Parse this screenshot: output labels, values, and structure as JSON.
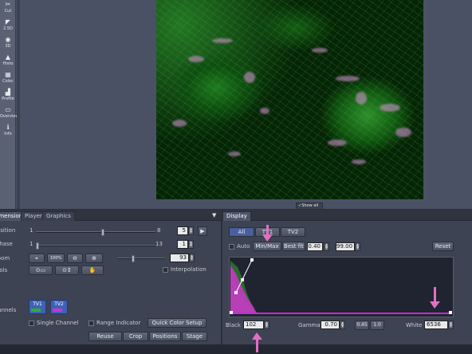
{
  "sidebar": {
    "tools": [
      {
        "icon": "scissors-icon",
        "label": "Cut"
      },
      {
        "icon": "2.5d-icon",
        "label": "2.5D"
      },
      {
        "icon": "3d-icon",
        "label": "3D"
      },
      {
        "icon": "histo-icon",
        "label": "Histo"
      },
      {
        "icon": "colocalization-icon",
        "label": "Coloc"
      },
      {
        "icon": "profile-icon",
        "label": "Profile"
      },
      {
        "icon": "overview-icon",
        "label": "Overview"
      },
      {
        "icon": "info-icon",
        "label": "Info"
      }
    ]
  },
  "image_view": {
    "show_all_label": "✓Show all"
  },
  "left_panel": {
    "tabs": [
      "Dimensions",
      "Player",
      "Graphics"
    ],
    "position": {
      "label": "Position",
      "min": "1",
      "max": "8",
      "value": "5"
    },
    "phase": {
      "label": "Phase",
      "min": "1",
      "max": "13",
      "value": "1"
    },
    "zoom": {
      "label": "Zoom",
      "value": "93",
      "percent_label": "100%"
    },
    "tools_label": "Tools",
    "interpolation_label": "Interpolation",
    "channels_label": "Channels",
    "tv1": {
      "label": "TV1",
      "color": "#2fae2f"
    },
    "tv2": {
      "label": "TV2",
      "color": "#d22fd2"
    },
    "single_channel_label": "Single Channel",
    "range_indicator_label": "Range Indicator",
    "quick_color_setup_label": "Quick Color Setup",
    "bottom_buttons": [
      "Reuse",
      "Crop",
      "Positions",
      "Stage"
    ]
  },
  "right_panel": {
    "tab": "Display",
    "channel_buttons": [
      "All",
      "TV1",
      "TV2"
    ],
    "auto_label": "Auto",
    "minmax_label": "Min/Max",
    "bestfit_label": "Best fit",
    "bestfit_low": "0.40",
    "bestfit_high": "99.00",
    "reset_label": "Reset",
    "black_label": "Black",
    "black_value": "102",
    "gamma_label": "Gamma",
    "gamma_value": "0.70",
    "gamma_preset_1": "0.45",
    "gamma_preset_2": "1.0",
    "white_label": "White",
    "white_value": "6536"
  },
  "colors": {
    "accent": "#e36fc4",
    "tv1": "#2fae2f",
    "tv2": "#d22fd2",
    "panel": "#3d4352"
  }
}
